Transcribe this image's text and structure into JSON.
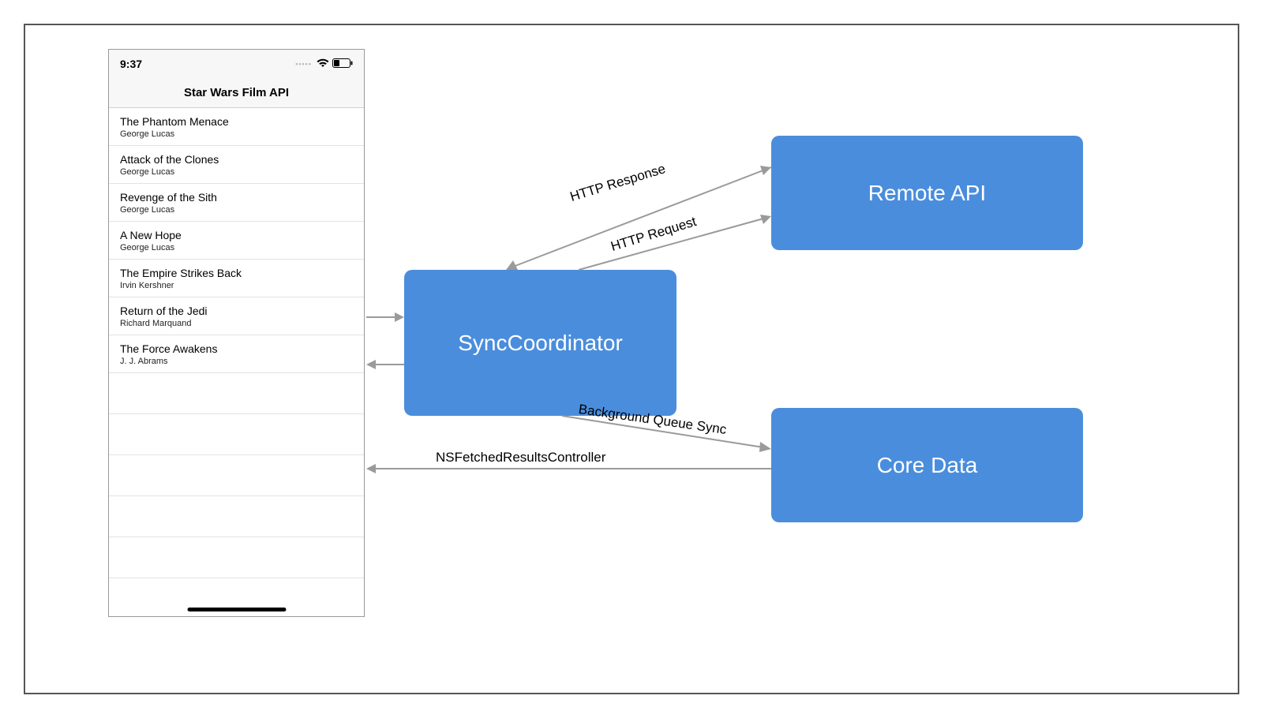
{
  "status": {
    "time": "9:37"
  },
  "nav": {
    "title": "Star Wars Film API"
  },
  "films": [
    {
      "title": "The Phantom Menace",
      "director": "George Lucas"
    },
    {
      "title": "Attack of the Clones",
      "director": "George Lucas"
    },
    {
      "title": "Revenge of the Sith",
      "director": "George Lucas"
    },
    {
      "title": "A New Hope",
      "director": "George Lucas"
    },
    {
      "title": "The Empire Strikes Back",
      "director": "Irvin Kershner"
    },
    {
      "title": "Return of the Jedi",
      "director": "Richard Marquand"
    },
    {
      "title": "The Force Awakens",
      "director": "J. J. Abrams"
    }
  ],
  "boxes": {
    "sync": "SyncCoordinator",
    "remote": "Remote API",
    "core": "Core Data"
  },
  "edges": {
    "http_response": "HTTP Response",
    "http_request": "HTTP Request",
    "bg_sync": "Background Queue Sync",
    "nsfrc": "NSFetchedResultsController"
  },
  "colors": {
    "box_bg": "#4a8ddc",
    "arrow": "#9a9a9a"
  }
}
